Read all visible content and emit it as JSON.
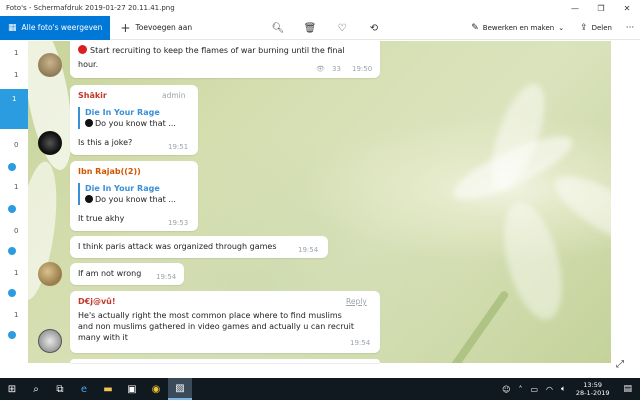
{
  "window": {
    "title": "Foto's - Schermafdruk 2019-01-27 20.11.41.png",
    "minimize": "—",
    "maximize": "❐",
    "close": "✕"
  },
  "toolbar": {
    "all_photos_label": "Alle foto's weergeven",
    "add_label": "Toevoegen aan",
    "edit_label": "Bewerken en maken",
    "share_label": "Delen",
    "more": "···"
  },
  "strip": {
    "labels": [
      "1",
      "1",
      "1",
      "0",
      "1",
      "0",
      "1",
      "1"
    ]
  },
  "chat": {
    "m1": {
      "text_line1": "Start recruiting to keep the flames of war burning until the final",
      "text_line2": "hour.",
      "views": "33",
      "time": "19:50"
    },
    "m2": {
      "sender": "Shākir",
      "role": "admin",
      "quote_name": "Die In Your Rage",
      "quote_text": "Do you know that ...",
      "text": "Is this a joke?",
      "time": "19:51"
    },
    "m3": {
      "sender": "Ibn Rajab((2))",
      "quote_name": "Die In Your Rage",
      "quote_text": "Do you know that ...",
      "text": "It true akhy",
      "time": "19:53"
    },
    "m4": {
      "text": "I think paris attack was organized through games",
      "time": "19:54"
    },
    "m5": {
      "text": "If am not wrong",
      "time": "19:54"
    },
    "m6": {
      "sender": "D€j@vû!",
      "reply": "Reply",
      "line1": "He's actually right the most common place where to find muslims",
      "line2": "and non muslims gathered in video games and actually u can recruit",
      "line3": "many with it",
      "time": "19:54"
    }
  },
  "taskbar": {
    "time": "13:59",
    "date": "28-1-2019"
  },
  "colors": {
    "accent": "#0078d7",
    "quote_blue": "#3a8fd9",
    "name_red": "#c0392b",
    "name_orange": "#d35400"
  }
}
